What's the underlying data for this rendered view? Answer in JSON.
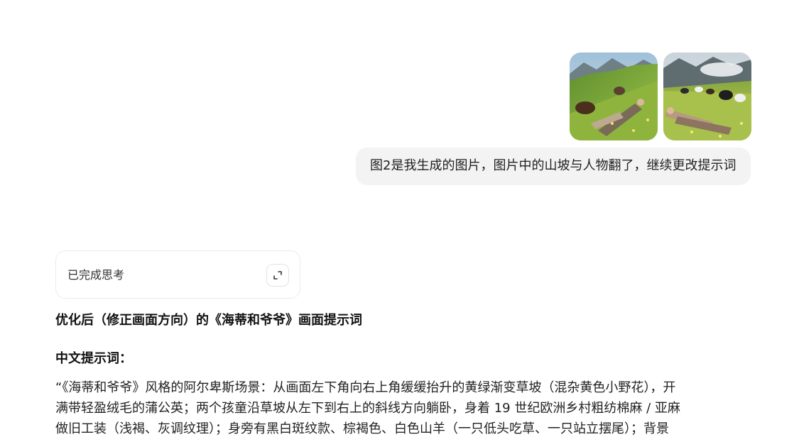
{
  "user_message": {
    "attachments": [
      {
        "name": "image-1",
        "description_icon": "image-thumbnail-icon"
      },
      {
        "name": "image-2",
        "description_icon": "image-thumbnail-icon"
      }
    ],
    "text": "图2是我生成的图片，图片中的山坡与人物翻了，继续更改提示词"
  },
  "thinking": {
    "label": "已完成思考",
    "expand_icon": "expand-icon"
  },
  "assistant": {
    "heading": "优化后（修正画面方向）的《海蒂和爷爷》画面提示词",
    "subheading": "中文提示词：",
    "paragraph_lines": [
      "“《海蒂和爷爷》风格的阿尔卑斯场景：从画面左下角向右上角缓缓抬升的黄绿渐变草坡（混杂黄色小野花），开",
      "满带轻盈绒毛的蒲公英；两个孩童沿草坡从左下到右上的斜线方向躺卧，身着 19 世纪欧洲乡村粗纺棉麻 / 亚麻",
      "做旧工装（浅褐、灰调纹理）；身旁有黑白斑纹款、棕褐色、白色山羊（一只低头吃草、一只站立摆尾）；背景"
    ]
  },
  "colors": {
    "bubble_bg": "#f3f3f3",
    "card_border": "#ebebeb",
    "text": "#1f1f1f"
  }
}
